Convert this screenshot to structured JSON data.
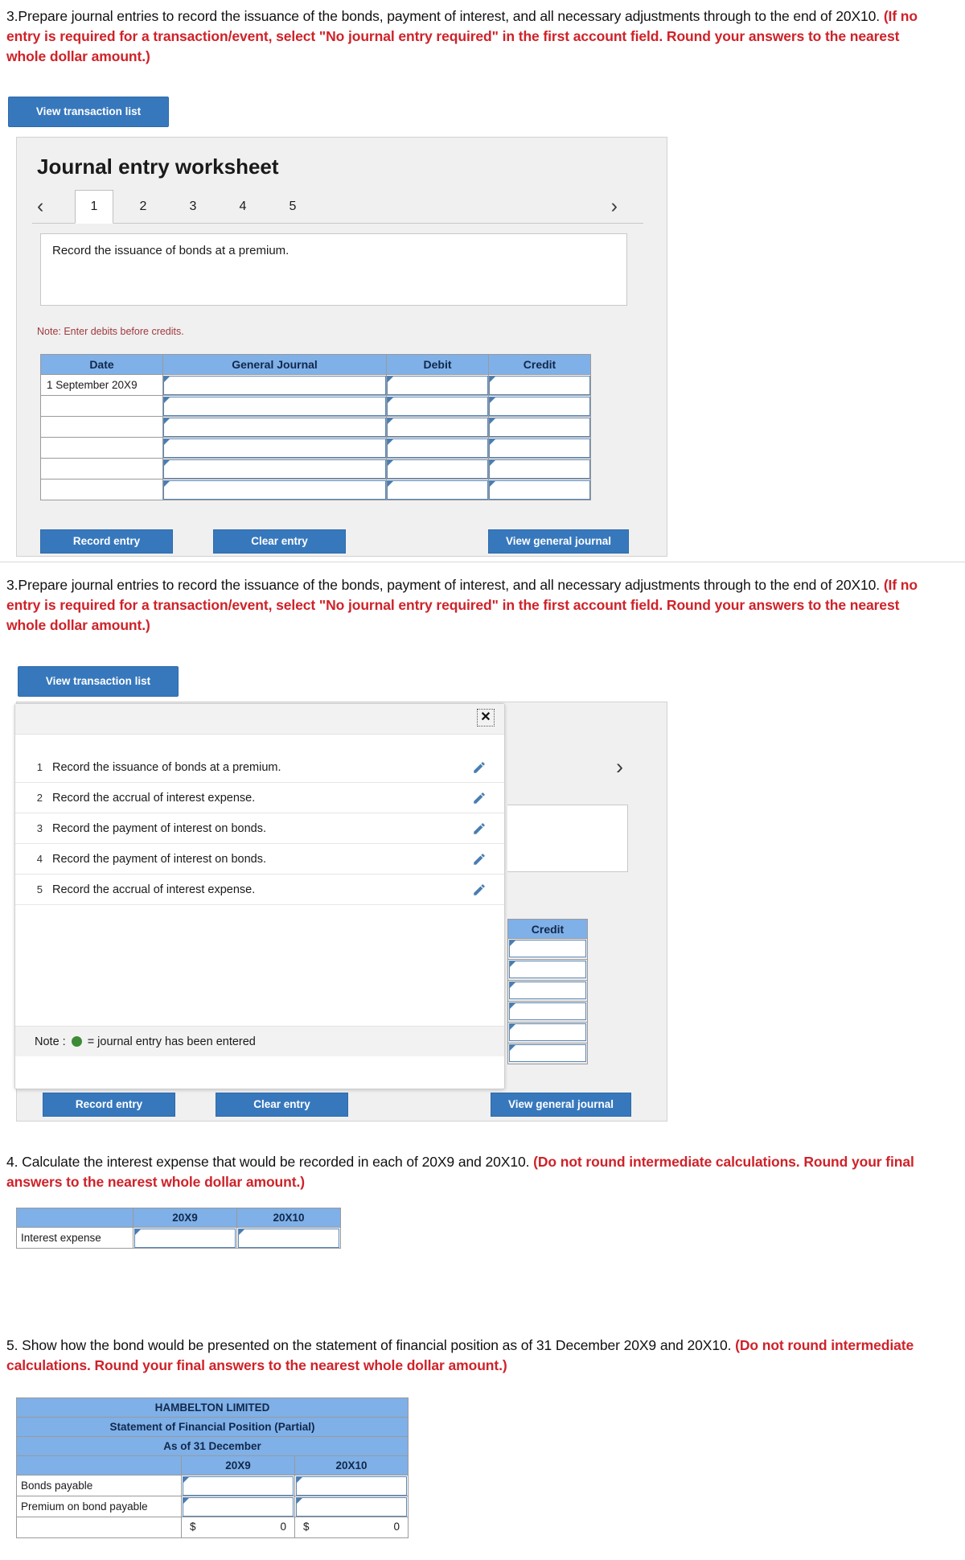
{
  "questions": {
    "q3_a": {
      "plain": "3.Prepare journal entries to record the issuance of the bonds, payment of interest, and all necessary adjustments through to the end of 20X10. ",
      "emphasis": "(If no entry is required for a transaction/event, select \"No journal entry required\" in the first account field. Round your answers to the nearest whole dollar amount.)"
    },
    "q3_b": {
      "plain": "3.Prepare journal entries to record the issuance of the bonds, payment of interest, and all necessary adjustments through to the end of 20X10. ",
      "emphasis": "(If no entry is required for a transaction/event, select \"No journal entry required\" in the first account field. Round your answers to the nearest whole dollar amount.)"
    },
    "q4": {
      "plain": "4. Calculate the interest expense that would be recorded in each of 20X9 and 20X10. ",
      "emphasis": "(Do not round intermediate calculations. Round your final answers to the nearest whole dollar amount.)"
    },
    "q5": {
      "plain": "5. Show how the bond would be presented on the statement of financial position as of 31 December 20X9 and 20X10. ",
      "emphasis": "(Do not round intermediate calculations. Round your final answers to the nearest whole dollar amount.)"
    }
  },
  "buttons": {
    "view_transaction_list": "View transaction list",
    "record_entry": "Record entry",
    "clear_entry": "Clear entry",
    "view_general_journal": "View general journal"
  },
  "worksheet": {
    "title": "Journal entry worksheet",
    "prev_icon": "‹",
    "next_icon": "›",
    "tabs": [
      "1",
      "2",
      "3",
      "4",
      "5"
    ],
    "active_tab": "1",
    "description": "Record the issuance of bonds at a premium.",
    "note": "Note: Enter debits before credits.",
    "columns": [
      "Date",
      "General Journal",
      "Debit",
      "Credit"
    ],
    "first_date": "1 September 20X9",
    "row_count": 6
  },
  "transaction_modal": {
    "close_label": "✕",
    "rows": [
      {
        "num": "1",
        "label": "Record the issuance of bonds at a premium."
      },
      {
        "num": "2",
        "label": "Record the accrual of interest expense."
      },
      {
        "num": "3",
        "label": "Record the payment of interest on bonds."
      },
      {
        "num": "4",
        "label": "Record the payment of interest on bonds."
      },
      {
        "num": "5",
        "label": "Record the accrual of interest expense."
      }
    ],
    "footer_prefix": "Note :",
    "footer_suffix": "= journal entry has been entered",
    "dot_color": "#3d8b37"
  },
  "credit_header": "Credit",
  "interest_table": {
    "col_blank": "",
    "col_20x9": "20X9",
    "col_20x10": "20X10",
    "row_label": "Interest expense"
  },
  "statement_table": {
    "company": "HAMBELTON LIMITED",
    "subtitle": "Statement of Financial Position (Partial)",
    "asof": "As of 31 December",
    "col_blank": "",
    "col_20x9": "20X9",
    "col_20x10": "20X10",
    "rows": [
      {
        "label": "Bonds payable"
      },
      {
        "label": "Premium on bond payable"
      }
    ],
    "total_currency": "$",
    "total_20x9": "0",
    "total_20x10": "0"
  },
  "colors": {
    "accent_blue": "#3778bd",
    "header_blue": "#7fb0e8",
    "red": "#cf2229",
    "green": "#3d8b37"
  }
}
